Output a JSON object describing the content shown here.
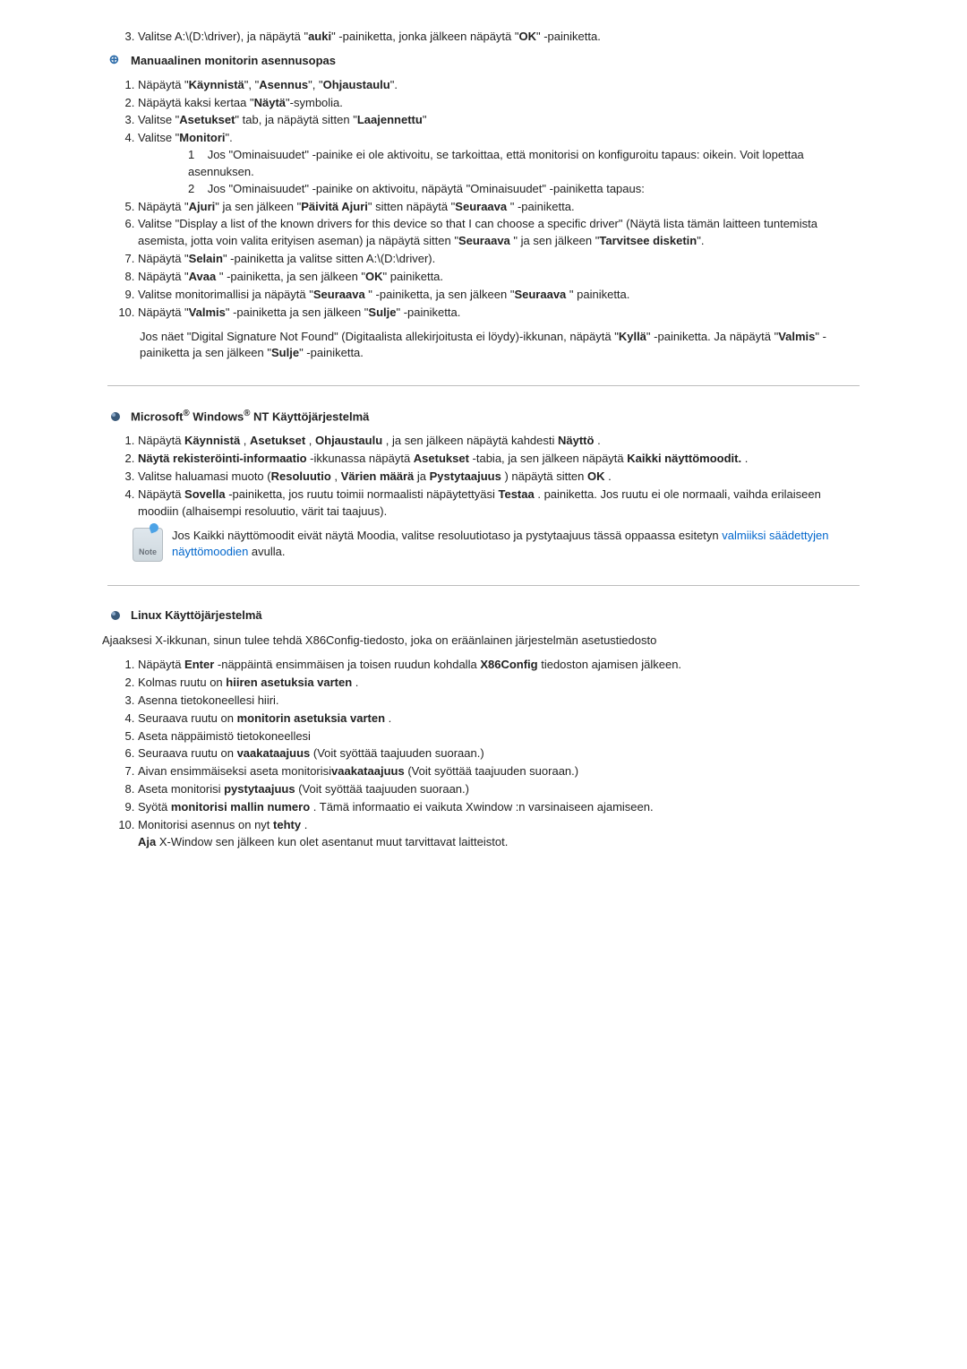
{
  "pre_list": {
    "item3": "Valitse A:\\(D:\\driver), ja näpäytä \"auki\" -painiketta, jonka jälkeen näpäytä \"OK\" -painiketta."
  },
  "section_manual": {
    "title": "Manuaalinen monitorin asennusopas",
    "items": [
      "Näpäytä \"Käynnistä\", \"Asennus\", \"Ohjaustaulu\".",
      "Näpäytä kaksi kertaa \"Näytä\"-symbolia.",
      "Valitse \"Asetukset\" tab, ja näpäytä sitten \"Laajennettu\"",
      "Valitse \"Monitori\"."
    ],
    "sub4_1": "Jos \"Ominaisuudet\" -painike ei ole aktivoitu, se tarkoittaa, että monitorisi on konfiguroitu tapaus: oikein. Voit lopettaa asennuksen.",
    "sub4_2": "Jos \"Ominaisuudet\" -painike on aktivoitu, näpäytä \"Ominaisuudet\" -painiketta tapaus:",
    "items5to10": [
      "Näpäytä \"Ajuri\" ja sen jälkeen \"Päivitä Ajuri\" sitten näpäytä \"Seuraava \" -painiketta.",
      "Valitse \"Display a list of the known drivers for this device so that I can choose a specific driver\" (Näytä lista tämän laitteen tuntemista asemista, jotta voin valita erityisen aseman) ja näpäytä sitten \"Seuraava \" ja sen jälkeen \"Tarvitsee disketin\".",
      "Näpäytä \"Selain\" -painiketta ja valitse sitten A:\\(D:\\driver).",
      "Näpäytä \"Avaa \" -painiketta, ja sen jälkeen \"OK\" painiketta.",
      "Valitse monitorimallisi ja näpäytä \"Seuraava \" -painiketta, ja sen jälkeen \"Seuraava \" painiketta.",
      "Näpäytä \"Valmis\" -painiketta ja sen jälkeen \"Sulje\" -painiketta."
    ],
    "post_para": "Jos näet \"Digital Signature Not Found\" (Digitaalista allekirjoitusta ei löydy)-ikkunan, näpäytä \"Kyllä\" -painiketta. Ja näpäytä \"Valmis\" -painiketta ja sen jälkeen \"Sulje\" -painiketta."
  },
  "section_nt": {
    "title_prefix": "Microsoft",
    "title_mid": " Windows",
    "title_suffix": " NT Käyttöjärjestelmä",
    "reg": "®",
    "items": [
      "Näpäytä Käynnistä , Asetukset , Ohjaustaulu , ja sen jälkeen näpäytä kahdesti Näyttö .",
      "Näytä rekisteröinti-informaatio -ikkunassa näpäytä Asetukset -tabia, ja sen jälkeen näpäytä Kaikki näyttömoodit. .",
      "Valitse haluamasi muoto (Resoluutio , Värien määrä ja Pystytaajuus ) näpäytä sitten OK .",
      "Näpäytä Sovella -painiketta, jos ruutu toimii normaalisti näpäytettyäsi Testaa . painiketta. Jos ruutu ei ole normaali, vaihda erilaiseen moodiin (alhaisempi resoluutio, värit tai taajuus)."
    ],
    "note_label": "Note",
    "note_text_a": "Jos Kaikki näyttömoodit eivät näytä Moodia, valitse resoluutiotaso ja pystytaajuus tässä oppaassa esitetyn ",
    "note_link": "valmiiksi säädettyjen näyttömoodien",
    "note_text_b": " avulla."
  },
  "section_linux": {
    "title": "Linux Käyttöjärjestelmä",
    "intro": "Ajaaksesi X-ikkunan, sinun tulee tehdä X86Config-tiedosto, joka on eräänlainen järjestelmän asetustiedosto",
    "items": [
      "Näpäytä Enter -näppäintä ensimmäisen ja toisen ruudun kohdalla X86Config tiedoston ajamisen jälkeen.",
      "Kolmas ruutu on hiiren asetuksia varten .",
      "Asenna tietokoneellesi hiiri.",
      "Seuraava ruutu on monitorin asetuksia varten .",
      "Aseta näppäimistö tietokoneellesi",
      "Seuraava ruutu on vaakataajuus (Voit syöttää taajuuden suoraan.)",
      "Aivan ensimmäiseksi aseta monitorisivaakataajuus (Voit syöttää taajuuden suoraan.)",
      "Aseta monitorisi pystytaajuus (Voit syöttää taajuuden suoraan.)",
      "Syötä monitorisi mallin numero . Tämä informaatio ei vaikuta Xwindow :n varsinaiseen ajamiseen.",
      "Monitorisi asennus on nyt tehty ."
    ],
    "post_line": "Aja X-Window sen jälkeen kun olet asentanut muut tarvittavat laitteistot."
  }
}
